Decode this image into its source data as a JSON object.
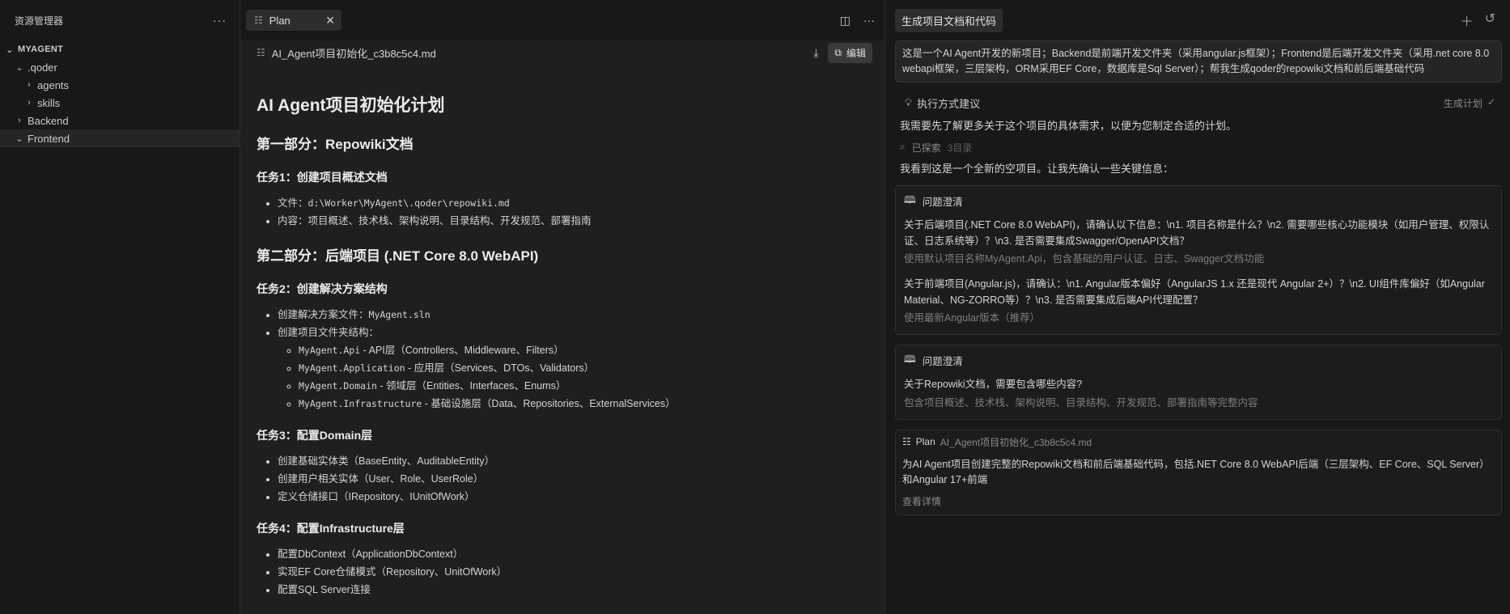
{
  "explorer": {
    "title": "资源管理器",
    "more": "···",
    "tree": [
      {
        "label": "MYAGENT",
        "chev": "⌄",
        "indent": 0
      },
      {
        "label": ".qoder",
        "chev": "⌄",
        "indent": 1
      },
      {
        "label": "agents",
        "chev": "›",
        "indent": 2
      },
      {
        "label": "skills",
        "chev": "›",
        "indent": 2
      },
      {
        "label": "Backend",
        "chev": "›",
        "indent": 1
      },
      {
        "label": "Frontend",
        "chev": "⌄",
        "indent": 1
      }
    ]
  },
  "editor": {
    "tab_label": "Plan",
    "tab_close": "✕",
    "file_name": "AI_Agent项目初始化_c3b8c5c4.md",
    "edit_label": "编辑",
    "doc": {
      "h1": "AI Agent项目初始化计划",
      "part1": "第一部分：Repowiki文档",
      "task1": "任务1：创建项目概述文档",
      "task1_file_label": "文件：",
      "task1_file_path": "d:\\Worker\\MyAgent\\.qoder\\repowiki.md",
      "task1_content": "内容：项目概述、技术栈、架构说明、目录结构、开发规范、部署指南",
      "part2": "第二部分：后端项目 (.NET Core 8.0 WebAPI)",
      "task2": "任务2：创建解决方案结构",
      "task2_sln_label": "创建解决方案文件：",
      "task2_sln_file": "MyAgent.sln",
      "task2_struct": "创建项目文件夹结构：",
      "task2_projects": [
        {
          "code": "MyAgent.Api",
          "desc": " - API层（Controllers、Middleware、Filters）"
        },
        {
          "code": "MyAgent.Application",
          "desc": " - 应用层（Services、DTOs、Validators）"
        },
        {
          "code": "MyAgent.Domain",
          "desc": " - 领域层（Entities、Interfaces、Enums）"
        },
        {
          "code": "MyAgent.Infrastructure",
          "desc": " - 基础设施层（Data、Repositories、ExternalServices）"
        }
      ],
      "task3": "任务3：配置Domain层",
      "task3_items": [
        "创建基础实体类（BaseEntity、AuditableEntity）",
        "创建用户相关实体（User、Role、UserRole）",
        "定义仓储接口（IRepository、IUnitOfWork）"
      ],
      "task4": "任务4：配置Infrastructure层",
      "task4_items": [
        "配置DbContext（ApplicationDbContext）",
        "实现EF Core仓储模式（Repository、UnitOfWork）",
        "配置SQL Server连接"
      ]
    }
  },
  "chat": {
    "title": "生成项目文档和代码",
    "prompt": "这是一个AI Agent开发的新项目；Backend是前端开发文件夹（采用angular.js框架）；Frontend是后端开发文件夹（采用.net core 8.0 webapi框架，三层架构，ORM采用EF Core，数据库是Sql Server）；帮我生成qoder的repowiki文档和前后端基础代码",
    "exec_label": "执行方式建议",
    "exec_action": "生成计划",
    "intro": "我需要先了解更多关于这个项目的具体需求，以便为您制定合适的计划。",
    "explored_label": "已探索",
    "explored_count": "3目录",
    "new_project": "我看到这是一个全新的空项目。让我先确认一些关键信息：",
    "clarify1": {
      "head": "问题澄清",
      "q1": "关于后端项目(.NET Core 8.0 WebAPI)，请确认以下信息：\\n1. 项目名称是什么？\\n2. 需要哪些核心功能模块（如用户管理、权限认证、日志系统等）？\\n3. 是否需要集成Swagger/OpenAPI文档？",
      "a1": "使用默认项目名称MyAgent.Api，包含基础的用户认证、日志、Swagger文档功能",
      "q2": "关于前端项目(Angular.js)，请确认：\\n1. Angular版本偏好（AngularJS 1.x 还是现代 Angular 2+）？\\n2. UI组件库偏好（如Angular Material、NG-ZORRO等）？\\n3. 是否需要集成后端API代理配置？",
      "a2": "使用最新Angular版本（推荐）"
    },
    "clarify2": {
      "head": "问题澄清",
      "q1": "关于Repowiki文档，需要包含哪些内容?",
      "a1": "包含项目概述、技术栈、架构说明、目录结构、开发规范、部署指南等完整内容"
    },
    "plan": {
      "label": "Plan",
      "file": "AI_Agent项目初始化_c3b8c5c4.md",
      "desc": "为AI Agent项目创建完整的Repowiki文档和前后端基础代码，包括.NET Core 8.0 WebAPI后端（三层架构、EF Core、SQL Server）和Angular 17+前端",
      "link": "查看详情"
    }
  }
}
